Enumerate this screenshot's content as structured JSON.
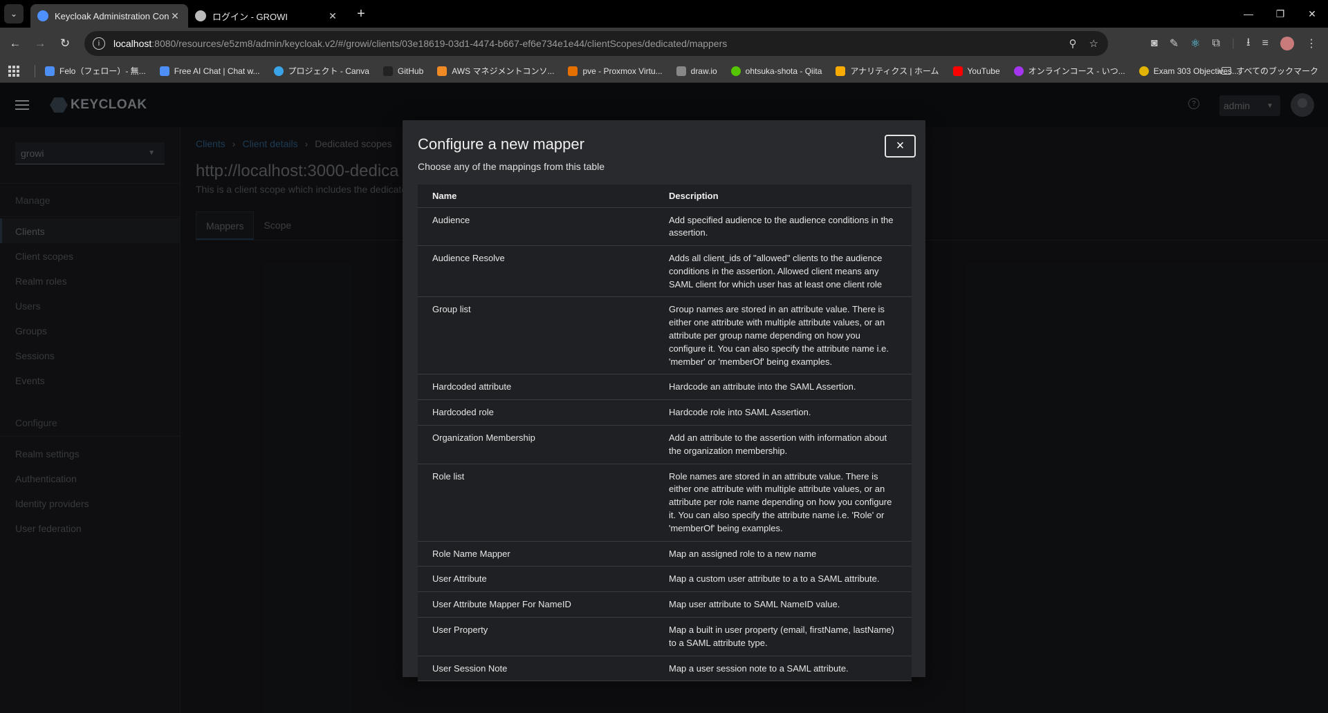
{
  "browser": {
    "tabs": [
      {
        "title": "Keycloak Administration Console",
        "favicon_color": "#4d90fe",
        "active": true
      },
      {
        "title": "ログイン - GROWI",
        "favicon_color": "#cccccc",
        "active": false
      }
    ],
    "url": {
      "host": "localhost",
      "rest": ":8080/resources/e5zm8/admin/keycloak.v2/#/growi/clients/03e18619-03d1-4474-b667-ef6e734e1e44/clientScopes/dedicated/mappers"
    },
    "bookmarks": [
      {
        "label": "Felo（フェロー）- 無...",
        "color": "#4d8ef7"
      },
      {
        "label": "Free AI Chat | Chat w...",
        "color": "#4d8ef7"
      },
      {
        "label": "プロジェクト - Canva",
        "color": "#3aa4e8"
      },
      {
        "label": "GitHub",
        "color": "#222222"
      },
      {
        "label": "AWS マネジメントコンソ...",
        "color": "#f08a24"
      },
      {
        "label": "pve - Proxmox Virtu...",
        "color": "#e57000"
      },
      {
        "label": "draw.io",
        "color": "#888888"
      },
      {
        "label": "ohtsuka-shota - Qiita",
        "color": "#55c500"
      },
      {
        "label": "アナリティクス | ホーム",
        "color": "#f9ab00"
      },
      {
        "label": "YouTube",
        "color": "#ff0000"
      },
      {
        "label": "オンラインコース - いつ...",
        "color": "#a435f0"
      },
      {
        "label": "Exam 303 Objectives...",
        "color": "#e0b400"
      }
    ],
    "all_bookmarks": "すべてのブックマーク"
  },
  "keycloak": {
    "logo": "KEYCLOAK",
    "user": "admin",
    "realm": "growi",
    "nav": {
      "manage_heading": "Manage",
      "manage_items": [
        "Clients",
        "Client scopes",
        "Realm roles",
        "Users",
        "Groups",
        "Sessions",
        "Events"
      ],
      "configure_heading": "Configure",
      "configure_items": [
        "Realm settings",
        "Authentication",
        "Identity providers",
        "User federation"
      ]
    },
    "breadcrumb": [
      "Clients",
      "Client details",
      "Dedicated scopes"
    ],
    "page_title": "http://localhost:3000-dedica",
    "page_subtitle": "This is a client scope which includes the dedicate",
    "tabs": [
      "Mappers",
      "Scope"
    ]
  },
  "modal": {
    "title": "Configure a new mapper",
    "description": "Choose any of the mappings from this table",
    "close_label": "×",
    "columns": [
      "Name",
      "Description"
    ],
    "rows": [
      {
        "name": "Audience",
        "desc": "Add specified audience to the audience conditions in the assertion."
      },
      {
        "name": "Audience Resolve",
        "desc": "Adds all client_ids of \"allowed\" clients to the audience conditions in the assertion. Allowed client means any SAML client for which user has at least one client role"
      },
      {
        "name": "Group list",
        "desc": "Group names are stored in an attribute value. There is either one attribute with multiple attribute values, or an attribute per group name depending on how you configure it. You can also specify the attribute name i.e. 'member' or 'memberOf' being examples."
      },
      {
        "name": "Hardcoded attribute",
        "desc": "Hardcode an attribute into the SAML Assertion."
      },
      {
        "name": "Hardcoded role",
        "desc": "Hardcode role into SAML Assertion."
      },
      {
        "name": "Organization Membership",
        "desc": "Add an attribute to the assertion with information about the organization membership."
      },
      {
        "name": "Role list",
        "desc": "Role names are stored in an attribute value. There is either one attribute with multiple attribute values, or an attribute per role name depending on how you configure it. You can also specify the attribute name i.e. 'Role' or 'memberOf' being examples."
      },
      {
        "name": "Role Name Mapper",
        "desc": "Map an assigned role to a new name"
      },
      {
        "name": "User Attribute",
        "desc": "Map a custom user attribute to a to a SAML attribute."
      },
      {
        "name": "User Attribute Mapper For NameID",
        "desc": "Map user attribute to SAML NameID value."
      },
      {
        "name": "User Property",
        "desc": "Map a built in user property (email, firstName, lastName) to a SAML attribute type."
      },
      {
        "name": "User Session Note",
        "desc": "Map a user session note to a SAML attribute."
      }
    ]
  }
}
